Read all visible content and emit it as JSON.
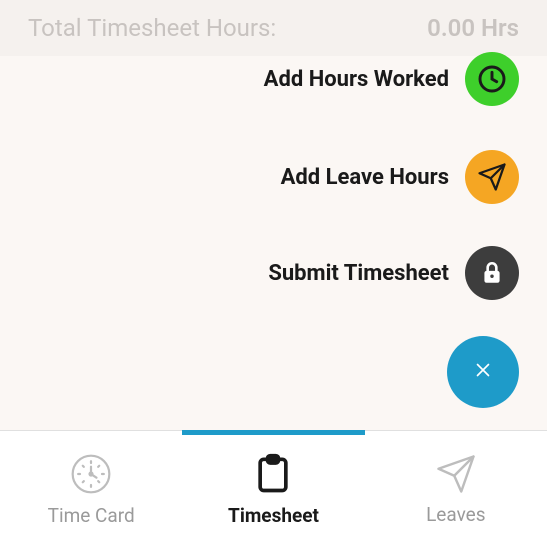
{
  "header": {
    "label": "Total Timesheet Hours:",
    "value": "0.00 Hrs"
  },
  "actions": {
    "addHours": "Add Hours Worked",
    "addLeave": "Add Leave Hours",
    "submit": "Submit Timesheet"
  },
  "tabs": {
    "timecard": "Time Card",
    "timesheet": "Timesheet",
    "leaves": "Leaves"
  },
  "colors": {
    "green": "#3ecf2b",
    "orange": "#f5a623",
    "dark": "#3d3d3d",
    "blue": "#1e9bc9"
  }
}
